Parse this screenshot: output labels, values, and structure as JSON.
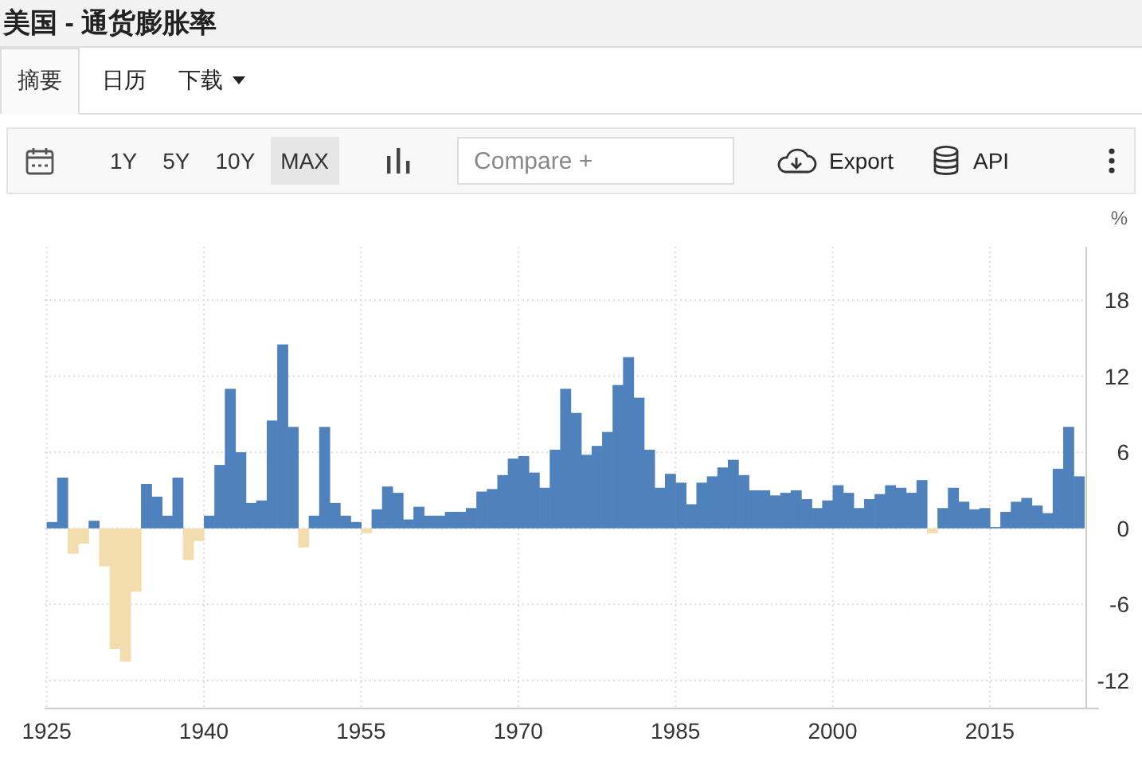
{
  "page_title": "美国 - 通货膨胀率",
  "tabs": [
    {
      "label": "摘要",
      "selected": true,
      "dropdown": false
    },
    {
      "label": "日历",
      "selected": false,
      "dropdown": false
    },
    {
      "label": "下载",
      "selected": false,
      "dropdown": true
    }
  ],
  "ranges": [
    {
      "label": "1Y",
      "selected": false
    },
    {
      "label": "5Y",
      "selected": false
    },
    {
      "label": "10Y",
      "selected": false
    },
    {
      "label": "MAX",
      "selected": true
    }
  ],
  "compare": {
    "placeholder": "Compare +"
  },
  "actions": [
    {
      "kind": "export",
      "label": "Export"
    },
    {
      "kind": "api",
      "label": "API"
    }
  ],
  "chart": {
    "chart_data": {
      "type": "bar",
      "ylabel": "%",
      "grid": true,
      "x": [
        1925,
        1926,
        1927,
        1928,
        1929,
        1930,
        1931,
        1932,
        1933,
        1934,
        1935,
        1936,
        1937,
        1938,
        1939,
        1940,
        1941,
        1942,
        1943,
        1944,
        1945,
        1946,
        1947,
        1948,
        1949,
        1950,
        1951,
        1952,
        1953,
        1954,
        1955,
        1956,
        1957,
        1958,
        1959,
        1960,
        1961,
        1962,
        1963,
        1964,
        1965,
        1966,
        1967,
        1968,
        1969,
        1970,
        1971,
        1972,
        1973,
        1974,
        1975,
        1976,
        1977,
        1978,
        1979,
        1980,
        1981,
        1982,
        1983,
        1984,
        1985,
        1986,
        1987,
        1988,
        1989,
        1990,
        1991,
        1992,
        1993,
        1994,
        1995,
        1996,
        1997,
        1998,
        1999,
        2000,
        2001,
        2002,
        2003,
        2004,
        2005,
        2006,
        2007,
        2008,
        2009,
        2010,
        2011,
        2012,
        2013,
        2014,
        2015,
        2016,
        2017,
        2018,
        2019,
        2020,
        2021,
        2022,
        2023
      ],
      "series": [
        {
          "color": "#4f81bd",
          "values": [
            0.5,
            4.0,
            null,
            null,
            0.6,
            null,
            null,
            null,
            null,
            3.5,
            2.5,
            1.0,
            4.0,
            null,
            null,
            1.0,
            5.0,
            11.0,
            6.0,
            2.0,
            2.2,
            8.5,
            14.5,
            8.0,
            null,
            1.0,
            8.0,
            2.0,
            1.0,
            0.5,
            null,
            1.5,
            3.3,
            2.8,
            0.7,
            1.7,
            1.0,
            1.0,
            1.3,
            1.3,
            1.6,
            2.9,
            3.1,
            4.2,
            5.5,
            5.7,
            4.4,
            3.2,
            6.2,
            11.0,
            9.1,
            5.8,
            6.5,
            7.6,
            11.3,
            13.5,
            10.3,
            6.2,
            3.2,
            4.3,
            3.6,
            1.9,
            3.6,
            4.1,
            4.8,
            5.4,
            4.2,
            3.0,
            3.0,
            2.6,
            2.8,
            3.0,
            2.3,
            1.6,
            2.2,
            3.4,
            2.8,
            1.6,
            2.3,
            2.7,
            3.4,
            3.2,
            2.8,
            3.8,
            null,
            1.6,
            3.2,
            2.1,
            1.5,
            1.6,
            0.1,
            1.3,
            2.1,
            2.4,
            1.8,
            1.2,
            4.7,
            8.0,
            4.1
          ]
        },
        {
          "color": "#f3dcae",
          "values": [
            null,
            null,
            -2.0,
            -1.2,
            null,
            -3.0,
            -9.5,
            -10.5,
            -5.0,
            null,
            null,
            null,
            null,
            -2.5,
            -1.0,
            null,
            null,
            null,
            null,
            null,
            null,
            null,
            null,
            null,
            -1.5,
            null,
            null,
            null,
            null,
            null,
            -0.4,
            null,
            null,
            null,
            null,
            null,
            null,
            null,
            null,
            null,
            null,
            null,
            null,
            null,
            null,
            null,
            null,
            null,
            null,
            null,
            null,
            null,
            null,
            null,
            null,
            null,
            null,
            null,
            null,
            null,
            null,
            null,
            null,
            null,
            null,
            null,
            null,
            null,
            null,
            null,
            null,
            null,
            null,
            null,
            null,
            null,
            null,
            null,
            null,
            null,
            null,
            null,
            null,
            null,
            -0.4,
            null,
            null,
            null,
            null,
            null,
            null,
            null,
            null,
            null,
            null,
            null,
            null,
            null,
            null
          ]
        }
      ],
      "xlim": [
        1924.8,
        2024.2
      ],
      "ylim": [
        -14.2,
        22.2
      ],
      "xticks": [
        1925,
        1940,
        1955,
        1970,
        1985,
        2000,
        2015
      ],
      "yticks": [
        -12,
        -6,
        0,
        6,
        12,
        18
      ]
    }
  }
}
